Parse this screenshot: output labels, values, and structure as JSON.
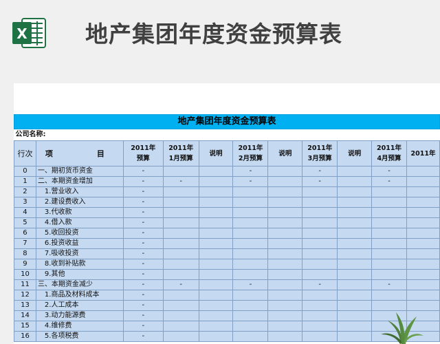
{
  "banner": {
    "title": "地产集团年度资金预算表",
    "app_icon": "excel-icon",
    "brand_color": "#1f7244"
  },
  "sheet": {
    "title": "地产集团年度资金预算表",
    "company_label": "公司名称:",
    "headers": {
      "seq": "行次",
      "item": "项　　目",
      "cols": [
        [
          "2011年",
          "预算"
        ],
        [
          "2011年",
          "1月预算"
        ],
        [
          "说明"
        ],
        [
          "2011年",
          "2月预算"
        ],
        [
          "说明"
        ],
        [
          "2011年",
          "3月预算"
        ],
        [
          "说明"
        ],
        [
          "2011年",
          "4月预算"
        ],
        [
          "2011年",
          ""
        ]
      ]
    },
    "rows": [
      {
        "seq": "0",
        "item": "一、期初货币资金",
        "vals": [
          "-",
          "",
          "",
          "-",
          "",
          "-",
          "",
          "-",
          ""
        ]
      },
      {
        "seq": "1",
        "item": "二、本期资金增加",
        "vals": [
          "-",
          "-",
          "",
          "-",
          "",
          "-",
          "",
          "-",
          ""
        ]
      },
      {
        "seq": "2",
        "item": "　1.营业收入",
        "vals": [
          "-",
          "",
          "",
          "",
          "",
          "",
          "",
          "",
          ""
        ]
      },
      {
        "seq": "3",
        "item": "　2.建设费收入",
        "vals": [
          "-",
          "",
          "",
          "",
          "",
          "",
          "",
          "",
          ""
        ]
      },
      {
        "seq": "4",
        "item": "　3.代收款",
        "vals": [
          "-",
          "",
          "",
          "",
          "",
          "",
          "",
          "",
          ""
        ]
      },
      {
        "seq": "5",
        "item": "　4.借入款",
        "vals": [
          "-",
          "",
          "",
          "",
          "",
          "",
          "",
          "",
          ""
        ]
      },
      {
        "seq": "6",
        "item": "　5.收回投资",
        "vals": [
          "-",
          "",
          "",
          "",
          "",
          "",
          "",
          "",
          ""
        ]
      },
      {
        "seq": "7",
        "item": "　6.投资收益",
        "vals": [
          "-",
          "",
          "",
          "",
          "",
          "",
          "",
          "",
          ""
        ]
      },
      {
        "seq": "8",
        "item": "　7.吸收投资",
        "vals": [
          "-",
          "",
          "",
          "",
          "",
          "",
          "",
          "",
          ""
        ]
      },
      {
        "seq": "9",
        "item": "　8.收到补贴款",
        "vals": [
          "-",
          "",
          "",
          "",
          "",
          "",
          "",
          "",
          ""
        ]
      },
      {
        "seq": "10",
        "item": "　9.其他",
        "vals": [
          "-",
          "",
          "",
          "",
          "",
          "",
          "",
          "",
          ""
        ]
      },
      {
        "seq": "11",
        "item": "三、本期资金减少",
        "vals": [
          "-",
          "-",
          "",
          "-",
          "",
          "-",
          "",
          "-",
          ""
        ]
      },
      {
        "seq": "12",
        "item": "　1.商品及材料成本",
        "vals": [
          "-",
          "",
          "",
          "",
          "",
          "",
          "",
          "",
          ""
        ]
      },
      {
        "seq": "13",
        "item": "　2.人工成本",
        "vals": [
          "-",
          "",
          "",
          "",
          "",
          "",
          "",
          "",
          ""
        ]
      },
      {
        "seq": "14",
        "item": "　3.动力能源费",
        "vals": [
          "-",
          "",
          "",
          "",
          "",
          "",
          "",
          "",
          ""
        ]
      },
      {
        "seq": "15",
        "item": "　4.维修费",
        "vals": [
          "-",
          "",
          "",
          "",
          "",
          "",
          "",
          "",
          ""
        ]
      },
      {
        "seq": "16",
        "item": "　5.各项税费",
        "vals": [
          "-",
          "",
          "",
          "",
          "",
          "",
          "",
          "",
          ""
        ]
      }
    ]
  },
  "decor": {
    "plant_icon": "plant-icon"
  }
}
